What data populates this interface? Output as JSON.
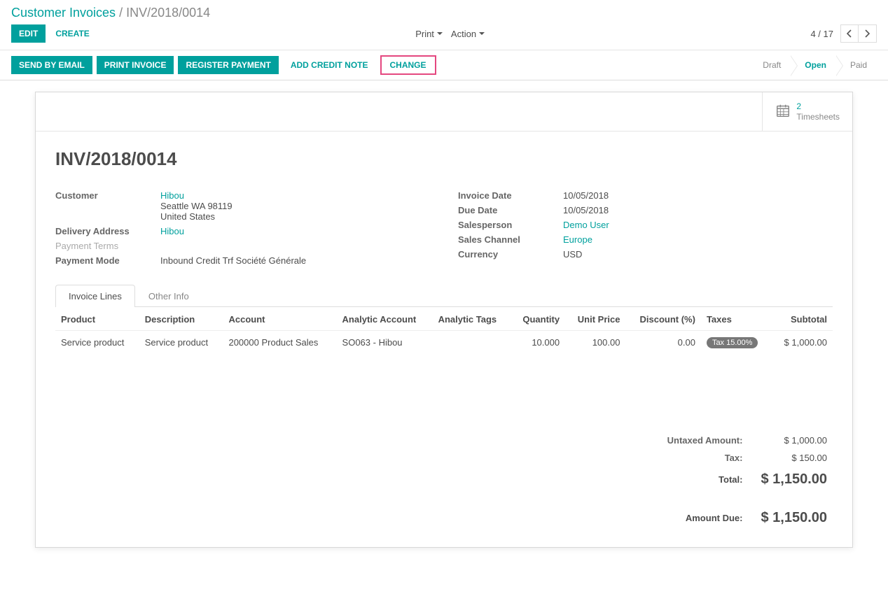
{
  "breadcrumb": {
    "root": "Customer Invoices",
    "sep": "/",
    "current": "INV/2018/0014"
  },
  "controls": {
    "edit": "Edit",
    "create": "Create",
    "print": "Print",
    "action": "Action",
    "pager": "4 / 17"
  },
  "actions": {
    "send_by_email": "Send by Email",
    "print_invoice": "Print Invoice",
    "register_payment": "Register Payment",
    "add_credit_note": "Add Credit Note",
    "change": "Change"
  },
  "status": {
    "draft": "Draft",
    "open": "Open",
    "paid": "Paid"
  },
  "stat": {
    "count": "2",
    "label": "Timesheets"
  },
  "record": {
    "title": "INV/2018/0014",
    "left": {
      "customer_label": "Customer",
      "customer_name": "Hibou",
      "customer_addr1": "Seattle WA 98119",
      "customer_addr2": "United States",
      "delivery_label": "Delivery Address",
      "delivery_value": "Hibou",
      "terms_label": "Payment Terms",
      "mode_label": "Payment Mode",
      "mode_value": "Inbound Credit Trf Société Générale"
    },
    "right": {
      "invoice_date_label": "Invoice Date",
      "invoice_date": "10/05/2018",
      "due_date_label": "Due Date",
      "due_date": "10/05/2018",
      "salesperson_label": "Salesperson",
      "salesperson": "Demo User",
      "channel_label": "Sales Channel",
      "channel": "Europe",
      "currency_label": "Currency",
      "currency": "USD"
    }
  },
  "tabs": {
    "lines": "Invoice Lines",
    "other": "Other Info"
  },
  "table": {
    "headers": {
      "product": "Product",
      "description": "Description",
      "account": "Account",
      "analytic_account": "Analytic Account",
      "analytic_tags": "Analytic Tags",
      "quantity": "Quantity",
      "unit_price": "Unit Price",
      "discount": "Discount (%)",
      "taxes": "Taxes",
      "subtotal": "Subtotal"
    },
    "rows": [
      {
        "product": "Service product",
        "description": "Service product",
        "account": "200000 Product Sales",
        "analytic_account": "SO063 - Hibou",
        "analytic_tags": "",
        "quantity": "10.000",
        "unit_price": "100.00",
        "discount": "0.00",
        "taxes": "Tax 15.00%",
        "subtotal": "$ 1,000.00"
      }
    ]
  },
  "totals": {
    "untaxed_label": "Untaxed Amount:",
    "untaxed": "$ 1,000.00",
    "tax_label": "Tax:",
    "tax": "$ 150.00",
    "total_label": "Total:",
    "total": "$ 1,150.00",
    "due_label": "Amount Due:",
    "due": "$ 1,150.00"
  }
}
